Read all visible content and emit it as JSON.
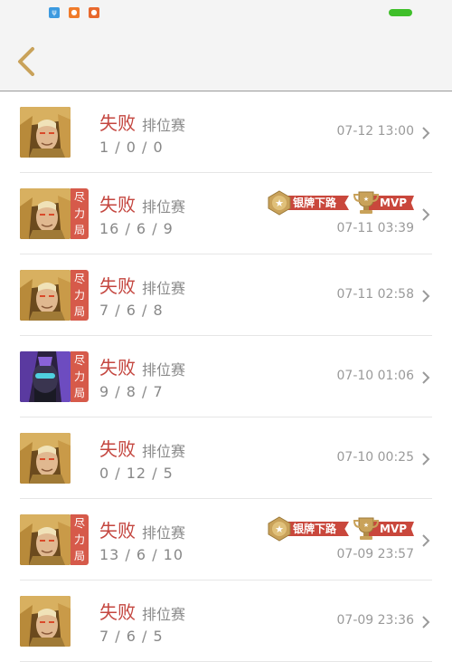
{
  "colors": {
    "accent_red": "#c4463f",
    "gold": "#c9a25a",
    "battery_green": "#3fbf2a",
    "tag_red": "#d65a4a",
    "badge_red": "#c9473c"
  },
  "statusbar": {
    "icons": [
      {
        "name": "usb-icon",
        "glyph": "ψ",
        "color": "#3c9ae0"
      },
      {
        "name": "app-notification-icon",
        "glyph": "●",
        "color": "#f07b2a"
      },
      {
        "name": "app-notification-icon-2",
        "glyph": "●",
        "color": "#e8692e"
      }
    ]
  },
  "header": {
    "back_icon": "chevron-left-icon"
  },
  "matches": [
    {
      "result": "失败",
      "mode": "排位赛",
      "kda": "1 / 0 / 0",
      "time": "07-12 13:00",
      "tag": "",
      "hero": "golden",
      "badges": []
    },
    {
      "result": "失败",
      "mode": "排位赛",
      "kda": "16 / 6 / 9",
      "time": "07-11 03:39",
      "tag": "尽力局",
      "hero": "golden",
      "badges": [
        {
          "text": "银牌下路",
          "icon": "star-medal-icon"
        },
        {
          "text": "MVP",
          "icon": "trophy-icon"
        }
      ]
    },
    {
      "result": "失败",
      "mode": "排位赛",
      "kda": "7 / 6 / 8",
      "time": "07-11 02:58",
      "tag": "尽力局",
      "hero": "golden",
      "badges": []
    },
    {
      "result": "失败",
      "mode": "排位赛",
      "kda": "9 / 8 / 7",
      "time": "07-10 01:06",
      "tag": "尽力局",
      "hero": "purple",
      "badges": []
    },
    {
      "result": "失败",
      "mode": "排位赛",
      "kda": "0 / 12 / 5",
      "time": "07-10 00:25",
      "tag": "",
      "hero": "golden",
      "badges": []
    },
    {
      "result": "失败",
      "mode": "排位赛",
      "kda": "13 / 6 / 10",
      "time": "07-09 23:57",
      "tag": "尽力局",
      "hero": "golden",
      "badges": [
        {
          "text": "银牌下路",
          "icon": "star-medal-icon"
        },
        {
          "text": "MVP",
          "icon": "trophy-icon"
        }
      ]
    },
    {
      "result": "失败",
      "mode": "排位赛",
      "kda": "7 / 6 / 5",
      "time": "07-09 23:36",
      "tag": "",
      "hero": "golden",
      "badges": []
    }
  ]
}
